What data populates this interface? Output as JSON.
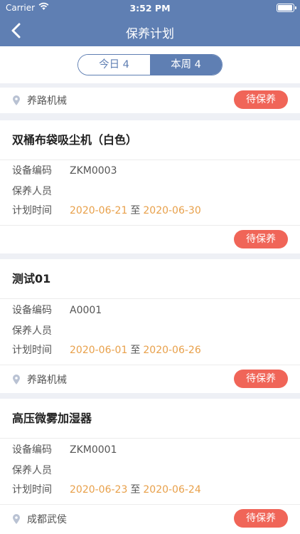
{
  "status_bar": {
    "carrier": "Carrier",
    "time": "3:52 PM"
  },
  "nav": {
    "title": "保养计划"
  },
  "tabs": [
    {
      "label": "今日  4",
      "active": false
    },
    {
      "label": "本周  4",
      "active": true
    }
  ],
  "labels": {
    "code": "设备编码",
    "staff": "保养人员",
    "plan_time": "计划时间",
    "to": "至"
  },
  "top_row": {
    "location": "养路机械",
    "status": "待保养"
  },
  "items": [
    {
      "title": "双桶布袋吸尘机（白色）",
      "code": "ZKM0003",
      "staff": "",
      "start": "2020-06-21",
      "end": "2020-06-30",
      "location": "",
      "status": "待保养"
    },
    {
      "title": "测试01",
      "code": "A0001",
      "staff": "",
      "start": "2020-06-01",
      "end": "2020-06-26",
      "location": "养路机械",
      "status": "待保养"
    },
    {
      "title": "高压微雾加湿器",
      "code": "ZKM0001",
      "staff": "",
      "start": "2020-06-23",
      "end": "2020-06-24",
      "location": "成都武侯",
      "status": "待保养"
    }
  ],
  "colors": {
    "primary": "#5f7fb3",
    "badge": "#f06558",
    "date": "#e8a04a",
    "background": "#eef0f5"
  }
}
